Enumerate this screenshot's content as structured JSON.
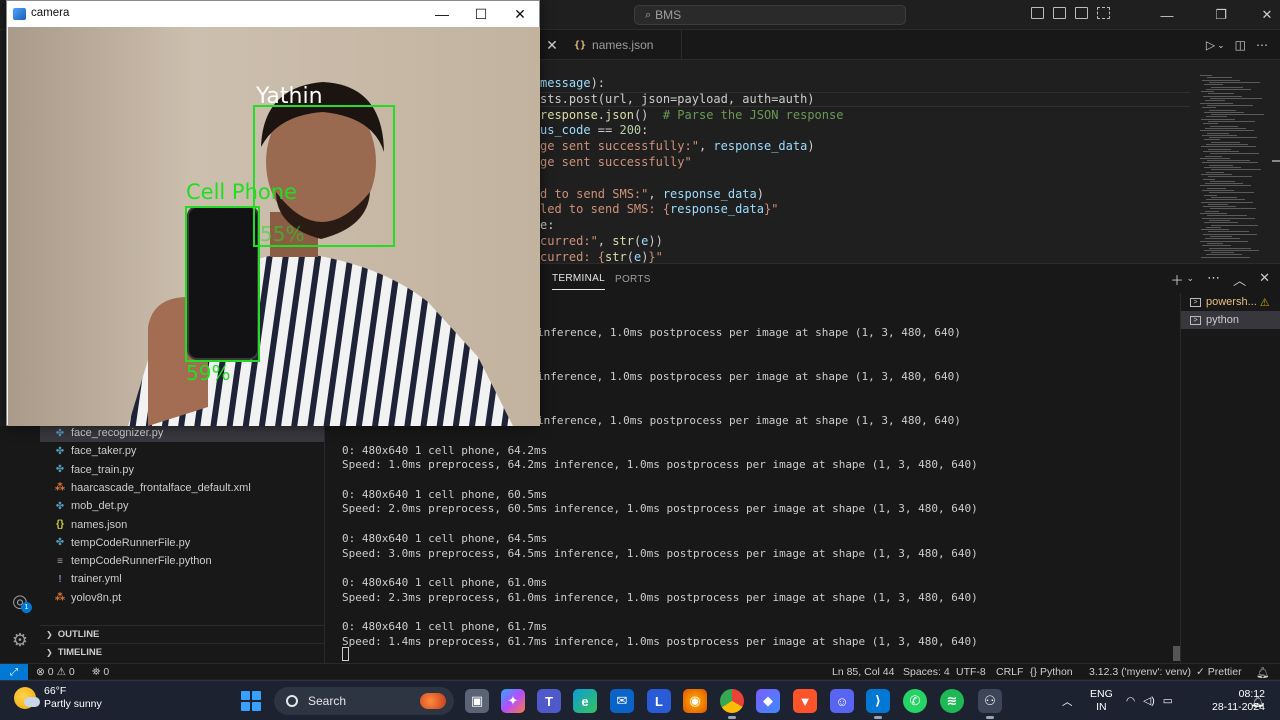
{
  "vscode": {
    "search_text": "BMS",
    "tab": {
      "icon": "json-braces-icon",
      "label": "names.json"
    },
    "code_lines": [
      {
        "parts": [
          [
            "var",
            "message"
          ],
          [
            "plain",
            "):"
          ]
        ]
      },
      {
        "parts": [
          [
            "plain",
            "sts.post(url, json=payload, auth=auth)"
          ]
        ]
      },
      {
        "parts": [
          [
            "fn",
            "response"
          ],
          [
            "plain",
            "."
          ],
          [
            "fn",
            "json"
          ],
          [
            "plain",
            "()  "
          ],
          [
            "cm",
            "# Parse the JSON response"
          ]
        ]
      },
      {
        "parts": [
          [
            "var",
            "us_code"
          ],
          [
            "plain",
            " == "
          ],
          [
            "num",
            "200"
          ],
          [
            "plain",
            ":"
          ]
        ]
      },
      {
        "parts": [
          [
            "str",
            "ge sent successfully:\""
          ],
          [
            "plain",
            ", "
          ],
          [
            "var",
            "response_data"
          ],
          [
            "plain",
            ")"
          ]
        ]
      },
      {
        "parts": [
          [
            "str",
            "ge sent successfully\""
          ]
        ]
      },
      {
        "parts": [
          [
            "plain",
            ""
          ]
        ]
      },
      {
        "parts": [
          [
            "str",
            "d to send SMS:\""
          ],
          [
            "plain",
            ", "
          ],
          [
            "var",
            "response_data"
          ],
          [
            "plain",
            ")"
          ]
        ]
      },
      {
        "parts": [
          [
            "str",
            "led to send SMS: {"
          ],
          [
            "var",
            "response_data"
          ],
          [
            "str",
            "}\""
          ]
        ]
      },
      {
        "parts": [
          [
            "plain",
            "e:"
          ]
        ]
      },
      {
        "parts": [
          [
            "str",
            "curred:\""
          ],
          [
            "plain",
            ", "
          ],
          [
            "fn",
            "str"
          ],
          [
            "plain",
            "("
          ],
          [
            "var",
            "e"
          ],
          [
            "plain",
            "))"
          ]
        ]
      },
      {
        "parts": [
          [
            "str",
            "curred: {"
          ],
          [
            "fn",
            "str"
          ],
          [
            "plain",
            "("
          ],
          [
            "var",
            "e"
          ],
          [
            "plain",
            ")"
          ],
          [
            "str",
            "}\""
          ]
        ]
      }
    ],
    "panel_tabs": [
      "TERMINAL",
      "PORTS"
    ],
    "terminal_lines": [
      "inference, 1.0ms postprocess per image at shape (1, 3, 480, 640)",
      "",
      "",
      "inference, 1.0ms postprocess per image at shape (1, 3, 480, 640)",
      "",
      "",
      "inference, 1.0ms postprocess per image at shape (1, 3, 480, 640)",
      "",
      "0: 480x640 1 cell phone, 64.2ms",
      "Speed: 1.0ms preprocess, 64.2ms inference, 1.0ms postprocess per image at shape (1, 3, 480, 640)",
      "",
      "0: 480x640 1 cell phone, 60.5ms",
      "Speed: 2.0ms preprocess, 60.5ms inference, 1.0ms postprocess per image at shape (1, 3, 480, 640)",
      "",
      "0: 480x640 1 cell phone, 64.5ms",
      "Speed: 3.0ms preprocess, 64.5ms inference, 1.0ms postprocess per image at shape (1, 3, 480, 640)",
      "",
      "0: 480x640 1 cell phone, 61.0ms",
      "Speed: 2.3ms preprocess, 61.0ms inference, 1.0ms postprocess per image at shape (1, 3, 480, 640)",
      "",
      "0: 480x640 1 cell phone, 61.7ms",
      "Speed: 1.4ms preprocess, 61.7ms inference, 1.0ms postprocess per image at shape (1, 3, 480, 640)"
    ],
    "terminal_sessions": [
      {
        "label": "powersh...",
        "warning": "⚠"
      },
      {
        "label": "python",
        "selected": true
      }
    ],
    "explorer_files": [
      {
        "name": "face_recognizer.py",
        "icon": "py",
        "selected": true
      },
      {
        "name": "face_taker.py",
        "icon": "py"
      },
      {
        "name": "face_train.py",
        "icon": "py"
      },
      {
        "name": "haarcascade_frontalface_default.xml",
        "icon": "xml"
      },
      {
        "name": "mob_det.py",
        "icon": "py"
      },
      {
        "name": "names.json",
        "icon": "json"
      },
      {
        "name": "tempCodeRunnerFile.py",
        "icon": "py"
      },
      {
        "name": "tempCodeRunnerFile.python",
        "icon": "txt"
      },
      {
        "name": "trainer.yml",
        "icon": "yml"
      },
      {
        "name": "yolov8n.pt",
        "icon": "pt"
      }
    ],
    "sections": [
      "OUTLINE",
      "TIMELINE"
    ],
    "account_badge": "1",
    "status": {
      "errors": "0",
      "warnings": "0",
      "ports": "0",
      "position": "Ln 85, Col 44",
      "spaces": "Spaces: 4",
      "encoding": "UTF-8",
      "eol": "CRLF",
      "language": "Python",
      "interpreter": "3.12.3 ('myenv': venv)",
      "formatter": "Prettier"
    }
  },
  "camera": {
    "title": "camera",
    "face_label": "Yathin",
    "face_conf": "55%",
    "object_label": "Cell Phone",
    "object_conf": "59%"
  },
  "taskbar": {
    "temperature": "66°F",
    "weather": "Partly sunny",
    "search_label": "Search",
    "lang_line1": "ENG",
    "lang_line2": "IN",
    "time": "08:12",
    "date": "28-11-2024",
    "accent": "#0078d4"
  }
}
